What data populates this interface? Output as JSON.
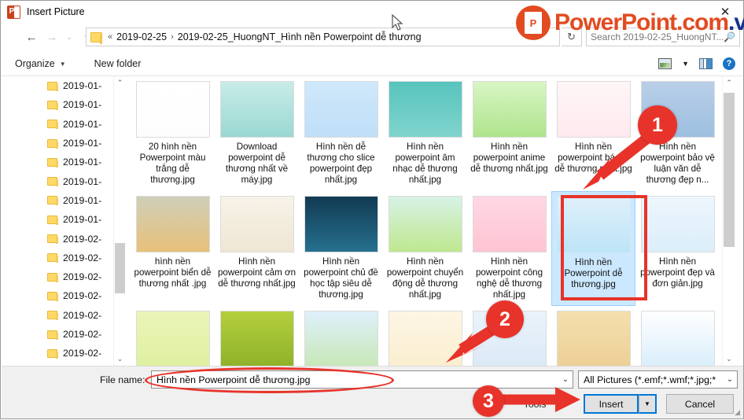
{
  "window": {
    "title": "Insert Picture",
    "app_icon": "powerpoint-icon",
    "close_label": "✕"
  },
  "address_bar": {
    "back": "←",
    "forward": "→",
    "recent": "⌄",
    "up": "↑",
    "crumb_prefix": "«",
    "crumb_1": "2019-02-25",
    "crumb_sep": "›",
    "crumb_2": "2019-02-25_HuongNT_Hình nền Powerpoint dễ thương",
    "refresh": "↻",
    "search_placeholder": "Search 2019-02-25_HuongNT...",
    "search_icon": "🔍"
  },
  "toolbar": {
    "organize": "Organize",
    "organize_caret": "▼",
    "new_folder": "New folder",
    "view_icon": "view-icon",
    "view_caret": "▼",
    "preview_pane_icon": "preview-pane-icon",
    "help": "?"
  },
  "nav_pane": {
    "items": [
      {
        "label": "2019-01-"
      },
      {
        "label": "2019-01-"
      },
      {
        "label": "2019-01-"
      },
      {
        "label": "2019-01-"
      },
      {
        "label": "2019-01-"
      },
      {
        "label": "2019-01-"
      },
      {
        "label": "2019-01-"
      },
      {
        "label": "2019-01-"
      },
      {
        "label": "2019-02-"
      },
      {
        "label": "2019-02-"
      },
      {
        "label": "2019-02-"
      },
      {
        "label": "2019-02-"
      },
      {
        "label": "2019-02-"
      },
      {
        "label": "2019-02-"
      },
      {
        "label": "2019-02-"
      }
    ],
    "scroll_up": "⌃",
    "scroll_down": "⌄"
  },
  "files": {
    "scroll_up": "⌃",
    "scroll_down": "⌄",
    "rows": [
      [
        {
          "name": "20 hình nền Powerpoint màu trắng dễ thương.jpg",
          "selected": false
        },
        {
          "name": "Download powerpoint dễ thương nhất về máy.jpg",
          "selected": false
        },
        {
          "name": "Hình nền dễ thương cho slice powerpoint đẹp nhất.jpg",
          "selected": false
        },
        {
          "name": "Hình nền powerpoint âm nhạc dễ thương nhất.jpg",
          "selected": false
        },
        {
          "name": "Hình nền powerpoint anime dễ thương nhất.jpg",
          "selected": false
        },
        {
          "name": "Hình nền powerpoint bác sĩ dễ thương nhất.jpg",
          "selected": false
        },
        {
          "name": "Hình nền powerpoint bảo vệ luận văn dễ thương đẹp n...",
          "selected": false
        }
      ],
      [
        {
          "name": "hình nền powerpoint biển dễ thương nhất .jpg",
          "selected": false
        },
        {
          "name": "Hình nền powerpoint cảm ơn dễ thương nhất.jpg",
          "selected": false
        },
        {
          "name": "Hình nền powerpoint chủ đề học tập siêu dễ thương.jpg",
          "selected": false
        },
        {
          "name": "Hình nền powerpoint chuyển động dễ thương nhất.jpg",
          "selected": false
        },
        {
          "name": "Hình nền powerpoint công nghệ dễ thương nhất.jpg",
          "selected": false
        },
        {
          "name": "Hình nền Powerpoint dễ thương.jpg",
          "selected": true
        },
        {
          "name": "Hình nền powerpoint đẹp và đơn giản.jpg",
          "selected": false
        }
      ],
      [
        {
          "name": "",
          "selected": false
        },
        {
          "name": "",
          "selected": false
        },
        {
          "name": "",
          "selected": false
        },
        {
          "name": "",
          "selected": false
        },
        {
          "name": "",
          "selected": false
        },
        {
          "name": "",
          "selected": false
        },
        {
          "name": "",
          "selected": false
        }
      ]
    ]
  },
  "bottom": {
    "file_name_label": "File name:",
    "file_name_value": "Hình nền Powerpoint dễ thương.jpg",
    "file_name_caret": "⌄",
    "file_type_value": "All Pictures (*.emf;*.wmf;*.jpg;*",
    "file_type_caret": "⌄",
    "tools_label": "Tools",
    "tools_caret": "▼",
    "insert_label": "Insert",
    "insert_caret": "▼",
    "cancel_label": "Cancel"
  },
  "watermark": {
    "badge_letter": "P",
    "text_main": "PowerPoint",
    "text_com": ".com",
    "text_vn": ".vn"
  },
  "annotations": {
    "badge_1": "1",
    "badge_2": "2",
    "badge_3": "3",
    "accent_color": "#e8332a"
  }
}
